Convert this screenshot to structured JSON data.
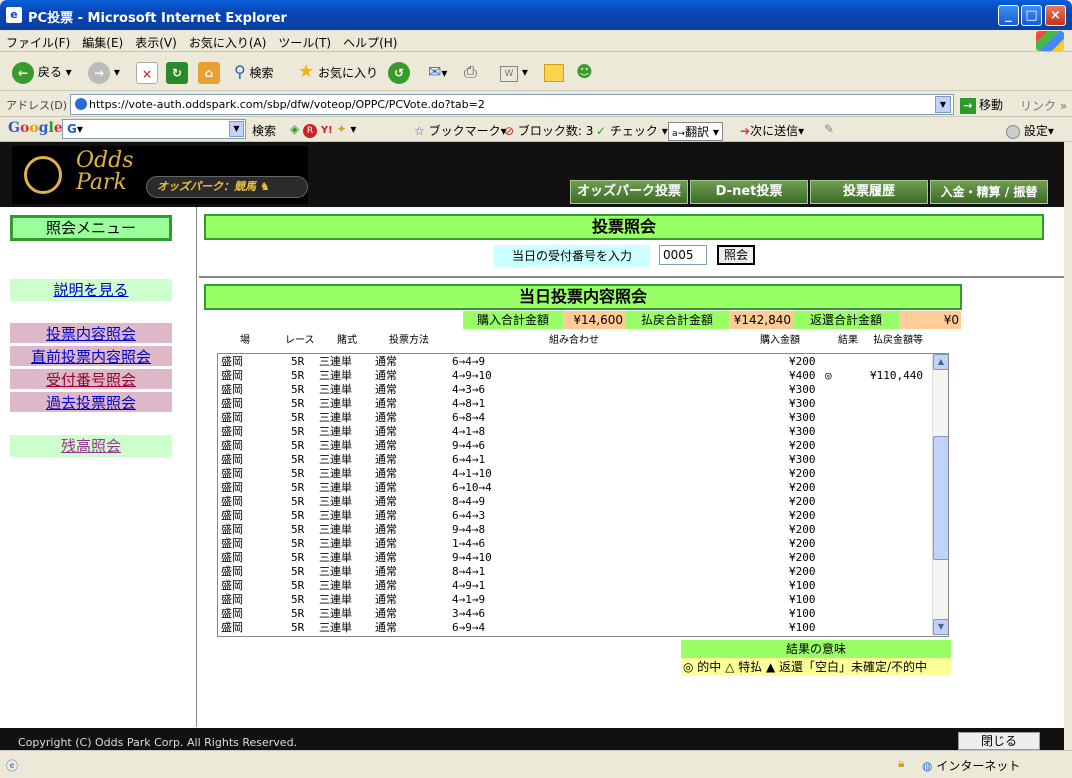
{
  "window": {
    "title": "PC投票 - Microsoft Internet Explorer"
  },
  "menu": [
    "ファイル(F)",
    "編集(E)",
    "表示(V)",
    "お気に入り(A)",
    "ツール(T)",
    "ヘルプ(H)"
  ],
  "toolbar": {
    "back": "戻る",
    "search": "検索",
    "favorites": "お気に入り"
  },
  "address": {
    "label": "アドレス(D)",
    "url": "https://vote-auth.oddspark.com/sbp/dfw/voteop/OPPC/PCVote.do?tab=2",
    "go": "移動",
    "links": "リンク"
  },
  "google": {
    "logo": "Google",
    "search": "検索",
    "bookmarks": "ブックマーク",
    "blocked": "ブロック数: 3",
    "check": "チェック",
    "translate": "翻訳",
    "send": "次に送信",
    "settings": "設定"
  },
  "site": {
    "logo_odds": "Odds",
    "logo_park": "Park",
    "logo_sub": "オッズパーク：競馬",
    "nav": [
      "オッズパーク投票",
      "D-net投票",
      "投票履歴",
      "入金・精算 / 振替"
    ],
    "left_head": "照会メニュー",
    "left_links": [
      "説明を見る",
      "投票内容照会",
      "直前投票内容照会",
      "受付番号照会",
      "過去投票照会",
      "残高照会"
    ],
    "inquiry_title": "投票照会",
    "receipt_label": "当日の受付番号を入力",
    "receipt_value": "0005",
    "receipt_button": "照会",
    "today_title": "当日投票内容照会",
    "purchase_total_label": "購入合計金額",
    "purchase_total": "¥14,600",
    "payout_total_label": "払戻合計金額",
    "payout_total": "¥142,840",
    "refund_total_label": "返還合計金額",
    "refund_total": "¥0",
    "columns": [
      "場",
      "レース",
      "賭式",
      "投票方法",
      "組み合わせ",
      "購入金額",
      "結果",
      "払戻金額等"
    ],
    "rows": [
      [
        "盛岡",
        "5R",
        "三連単",
        "通常",
        "6→4→9",
        "¥200",
        "",
        ""
      ],
      [
        "盛岡",
        "5R",
        "三連単",
        "通常",
        "4→9→10",
        "¥400",
        "◎",
        "¥110,440"
      ],
      [
        "盛岡",
        "5R",
        "三連単",
        "通常",
        "4→3→6",
        "¥300",
        "",
        ""
      ],
      [
        "盛岡",
        "5R",
        "三連単",
        "通常",
        "4→8→1",
        "¥300",
        "",
        ""
      ],
      [
        "盛岡",
        "5R",
        "三連単",
        "通常",
        "6→8→4",
        "¥300",
        "",
        ""
      ],
      [
        "盛岡",
        "5R",
        "三連単",
        "通常",
        "4→1→8",
        "¥300",
        "",
        ""
      ],
      [
        "盛岡",
        "5R",
        "三連単",
        "通常",
        "9→4→6",
        "¥200",
        "",
        ""
      ],
      [
        "盛岡",
        "5R",
        "三連単",
        "通常",
        "6→4→1",
        "¥300",
        "",
        ""
      ],
      [
        "盛岡",
        "5R",
        "三連単",
        "通常",
        "4→1→10",
        "¥200",
        "",
        ""
      ],
      [
        "盛岡",
        "5R",
        "三連単",
        "通常",
        "6→10→4",
        "¥200",
        "",
        ""
      ],
      [
        "盛岡",
        "5R",
        "三連単",
        "通常",
        "8→4→9",
        "¥200",
        "",
        ""
      ],
      [
        "盛岡",
        "5R",
        "三連単",
        "通常",
        "6→4→3",
        "¥200",
        "",
        ""
      ],
      [
        "盛岡",
        "5R",
        "三連単",
        "通常",
        "9→4→8",
        "¥200",
        "",
        ""
      ],
      [
        "盛岡",
        "5R",
        "三連単",
        "通常",
        "1→4→6",
        "¥200",
        "",
        ""
      ],
      [
        "盛岡",
        "5R",
        "三連単",
        "通常",
        "9→4→10",
        "¥200",
        "",
        ""
      ],
      [
        "盛岡",
        "5R",
        "三連単",
        "通常",
        "8→4→1",
        "¥200",
        "",
        ""
      ],
      [
        "盛岡",
        "5R",
        "三連単",
        "通常",
        "4→9→1",
        "¥100",
        "",
        ""
      ],
      [
        "盛岡",
        "5R",
        "三連単",
        "通常",
        "4→1→9",
        "¥100",
        "",
        ""
      ],
      [
        "盛岡",
        "5R",
        "三連単",
        "通常",
        "3→4→6",
        "¥100",
        "",
        ""
      ],
      [
        "盛岡",
        "5R",
        "三連単",
        "通常",
        "6→9→4",
        "¥100",
        "",
        ""
      ]
    ],
    "legend_title": "結果の意味",
    "legend_text": "◎ 的中 △ 特払 ▲ 返還「空白」未確定/不的中",
    "footer_copy": "Copyright (C) Odds Park Corp. All Rights Reserved.",
    "footer_close": "閉じる"
  },
  "status": {
    "zone": "インターネット"
  },
  "colors": {
    "green_bar": "#99ff66",
    "pink": "#ffcc99",
    "lightblue": "#ccffff",
    "nav_green": "#5a8a3c"
  }
}
